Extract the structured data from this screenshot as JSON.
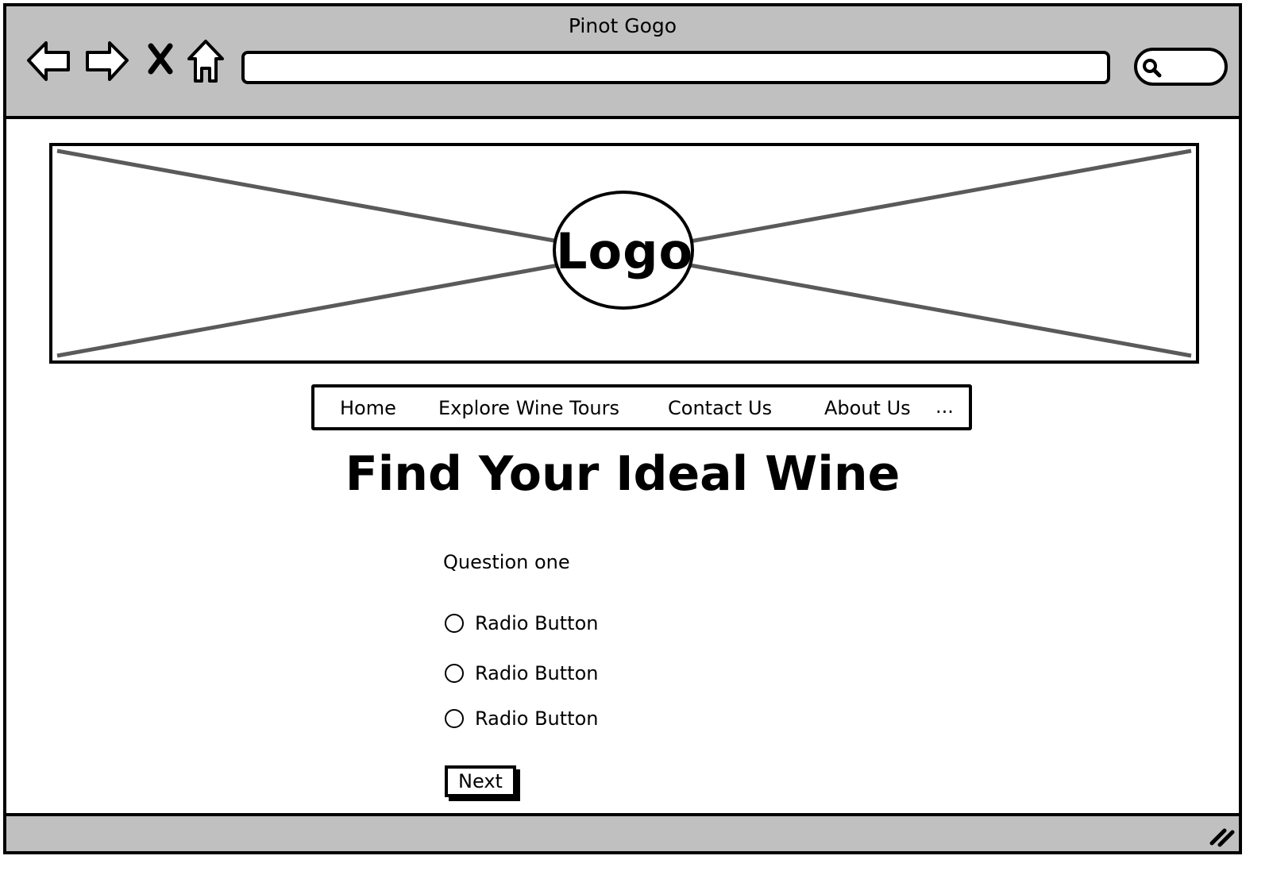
{
  "window": {
    "title": "Pinot Gogo"
  },
  "browser": {
    "address_value": "",
    "search_value": "",
    "icons": [
      "back-arrow-icon",
      "forward-arrow-icon",
      "close-x-icon",
      "home-icon",
      "search-icon",
      "resize-grip-icon"
    ]
  },
  "logo": {
    "text": "Logo"
  },
  "nav": {
    "items": [
      {
        "label": "Home"
      },
      {
        "label": "Explore Wine Tours"
      },
      {
        "label": "Contact Us"
      },
      {
        "label": "About Us"
      },
      {
        "label": "..."
      }
    ]
  },
  "main": {
    "title": "Find Your Ideal Wine",
    "question_label": "Question one",
    "options": [
      {
        "label": "Radio Button",
        "selected": false
      },
      {
        "label": "Radio Button",
        "selected": false
      },
      {
        "label": "Radio Button",
        "selected": false
      }
    ],
    "next_label": "Next"
  },
  "colors": {
    "chrome_gray": "#c0c0c0",
    "ink": "#000000",
    "placeholder_lines": "#5a5a5a"
  }
}
